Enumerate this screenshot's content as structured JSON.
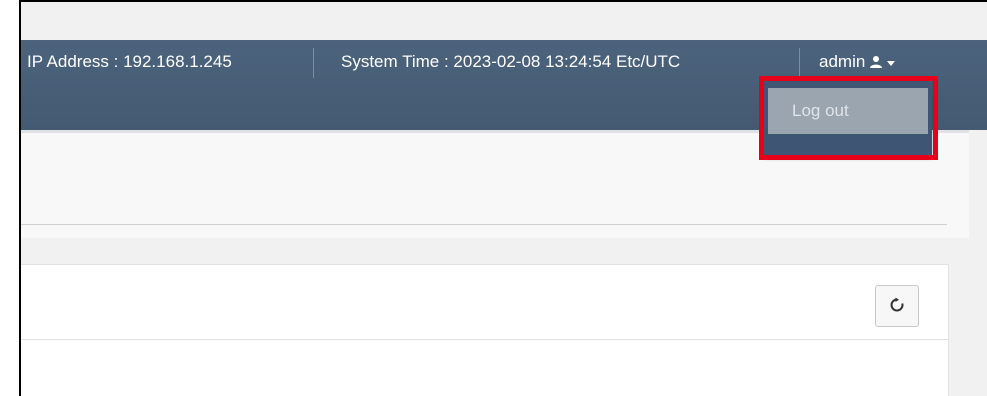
{
  "navbar": {
    "ip_address": "IP Address : 192.168.1.245",
    "system_time": "System Time : 2023-02-08 13:24:54 Etc/UTC",
    "username": "admin",
    "user_icon": "user-icon",
    "caret_icon": "caret-down-icon"
  },
  "dropdown": {
    "logout_label": "Log out"
  },
  "content": {
    "refresh_icon": "refresh-icon"
  },
  "colors": {
    "navbar": "#4c637d",
    "dropdown": "#3e5573",
    "highlight": "#e8001a"
  }
}
